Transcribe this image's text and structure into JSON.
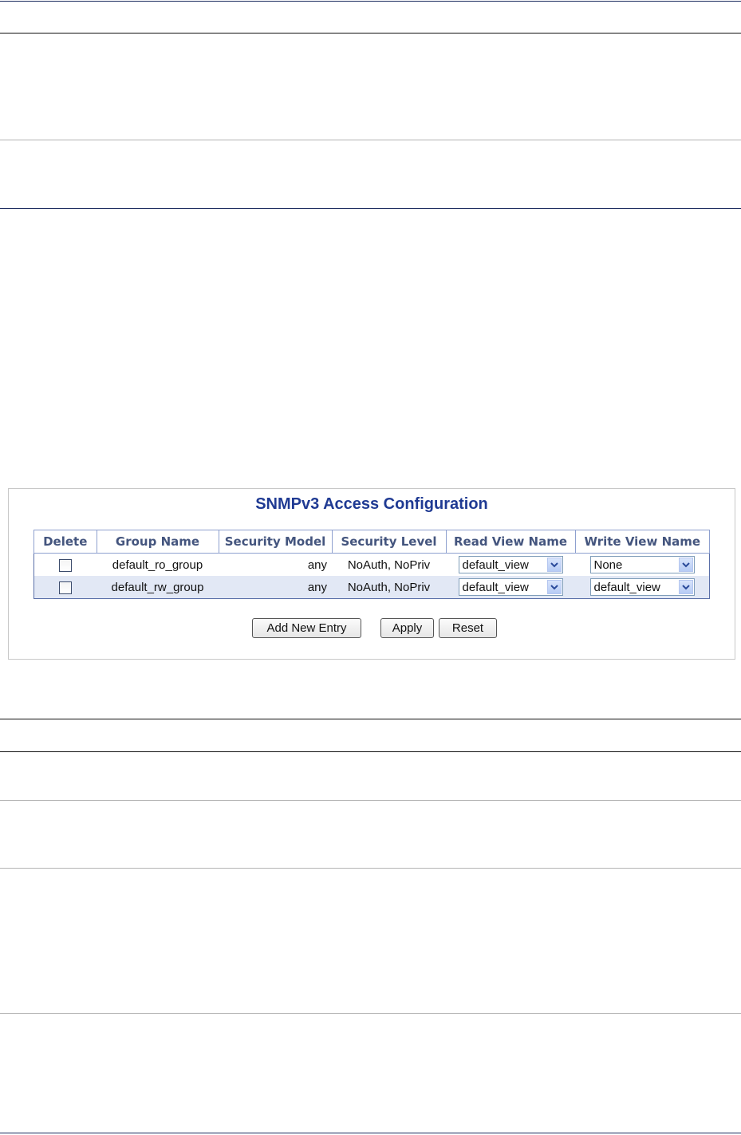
{
  "panel": {
    "title": "SNMPv3 Access Configuration"
  },
  "table": {
    "headers": [
      "Delete",
      "Group Name",
      "Security Model",
      "Security Level",
      "Read View Name",
      "Write View Name"
    ],
    "rows": [
      {
        "delete_checked": false,
        "group_name": "default_ro_group",
        "security_model": "any",
        "security_level": "NoAuth, NoPriv",
        "read_view": "default_view",
        "write_view": "None"
      },
      {
        "delete_checked": false,
        "group_name": "default_rw_group",
        "security_model": "any",
        "security_level": "NoAuth, NoPriv",
        "read_view": "default_view",
        "write_view": "default_view"
      }
    ]
  },
  "buttons": {
    "add_new_entry": "Add New Entry",
    "apply": "Apply",
    "reset": "Reset"
  },
  "icons": {
    "dropdown": "chevron-down-icon",
    "checkbox": "checkbox-icon"
  },
  "colors": {
    "title": "#1f3a93",
    "header_text": "#44557e",
    "table_border": "#5a6fa8",
    "alt_row": "#e2e8f5",
    "rule_navy": "#1a2a5e"
  }
}
